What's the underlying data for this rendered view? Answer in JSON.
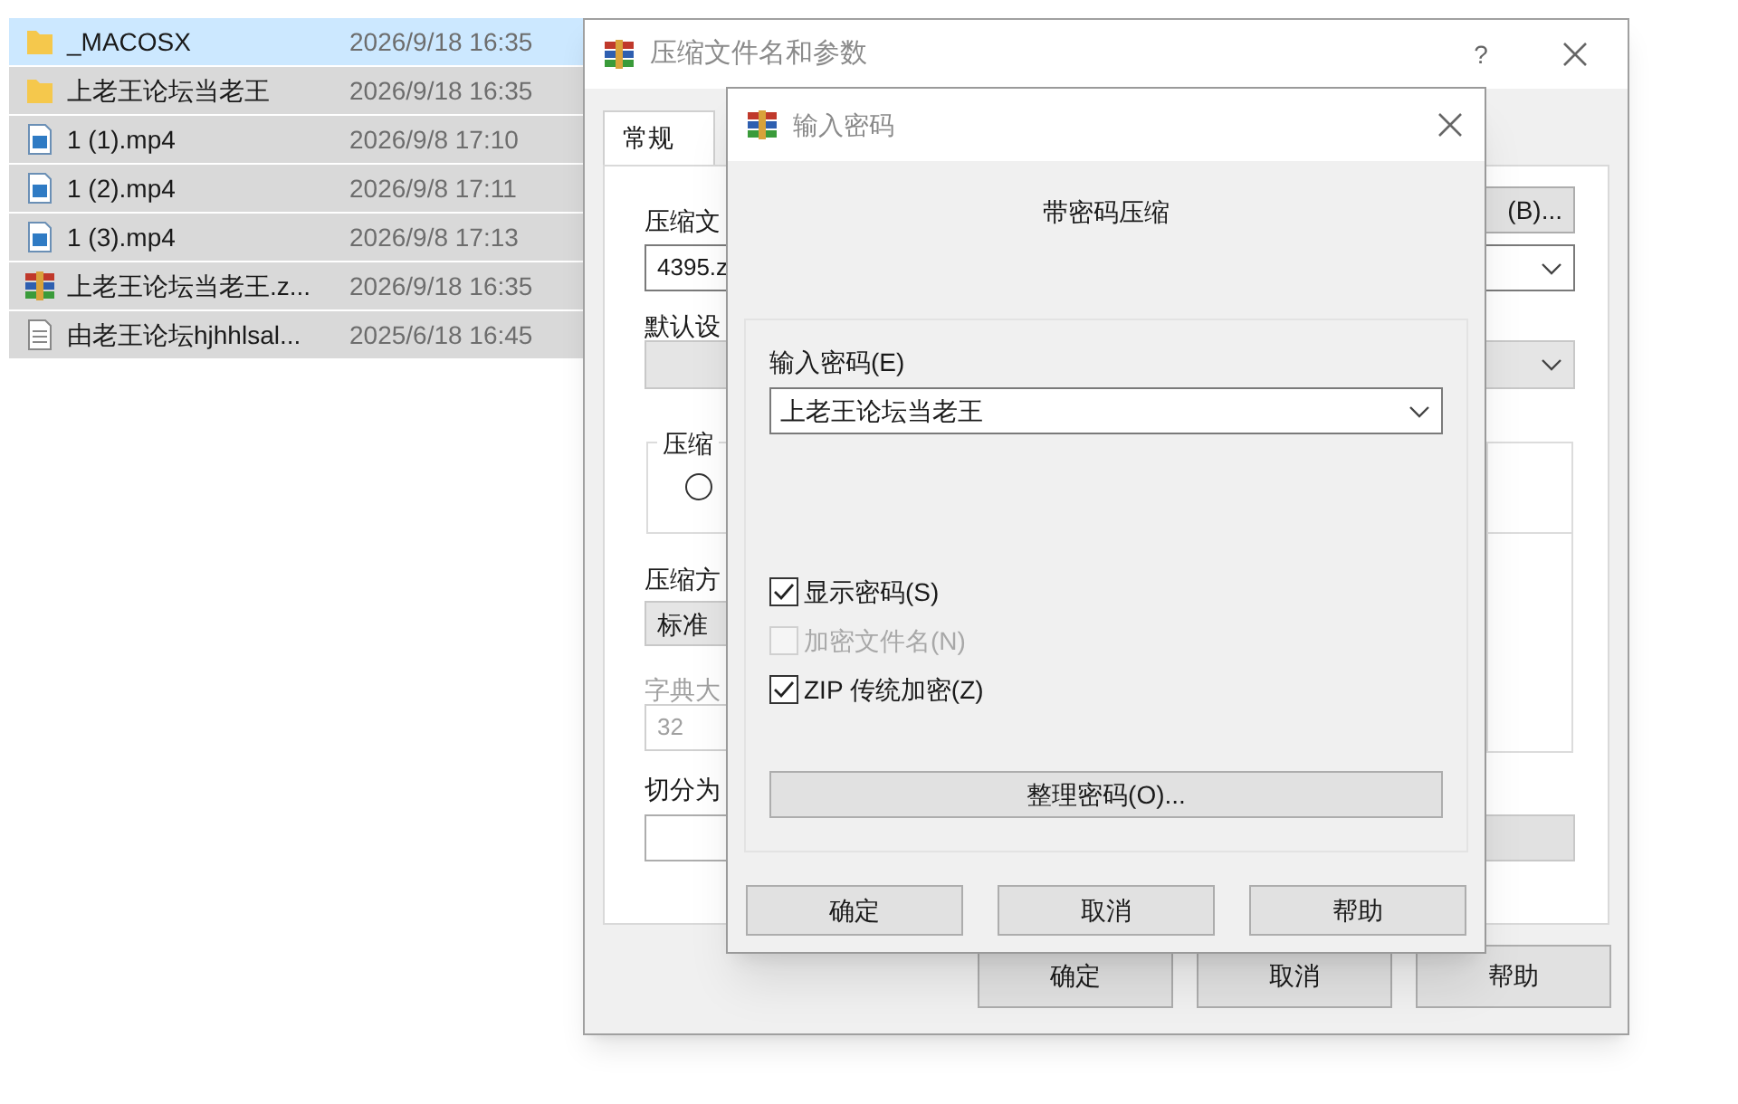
{
  "file_list": [
    {
      "name": "_MACOSX",
      "modified": "2026/9/18 16:35",
      "kind": "folder",
      "selected": true
    },
    {
      "name": "上老王论坛当老王",
      "modified": "2026/9/18 16:35",
      "kind": "folder",
      "selected": false
    },
    {
      "name": "1 (1).mp4",
      "modified": "2026/9/8 17:10",
      "kind": "video",
      "selected": false
    },
    {
      "name": "1 (2).mp4",
      "modified": "2026/9/8 17:11",
      "kind": "video",
      "selected": false
    },
    {
      "name": "1 (3).mp4",
      "modified": "2026/9/8 17:13",
      "kind": "video",
      "selected": false
    },
    {
      "name": "上老王论坛当老王.z...",
      "modified": "2026/9/18 16:35",
      "kind": "archive",
      "selected": false
    },
    {
      "name": "由老王论坛hjhhlsal...",
      "modified": "2025/6/18 16:45",
      "kind": "text",
      "selected": false
    }
  ],
  "archive_dialog": {
    "title": "压缩文件名和参数",
    "help_button": "?",
    "tabs": [
      {
        "label": "常规",
        "selected": true
      }
    ],
    "archive_name_label": "压缩文",
    "browse_button": "(B)...",
    "archive_name_value": "4395.z",
    "profile_label": "默认设",
    "format_group_label": "压缩",
    "format_radio_selected": false,
    "method_label": "压缩方",
    "method_value": "标准",
    "dictionary": {
      "label": "字典大",
      "value": "32",
      "disabled": true
    },
    "split_label": "切分为",
    "buttons": [
      "确定",
      "取消",
      "帮助"
    ]
  },
  "password_dialog": {
    "title": "输入密码",
    "heading": "带密码压缩",
    "password_label": "输入密码(E)",
    "password_value": "上老王论坛当老王",
    "options": [
      {
        "label": "显示密码(S)",
        "checked": true,
        "disabled": false
      },
      {
        "label": "加密文件名(N)",
        "checked": false,
        "disabled": true
      },
      {
        "label": "ZIP 传统加密(Z)",
        "checked": true,
        "disabled": false
      }
    ],
    "organize_button": "整理密码(O)...",
    "buttons": [
      "确定",
      "取消",
      "帮助"
    ]
  }
}
